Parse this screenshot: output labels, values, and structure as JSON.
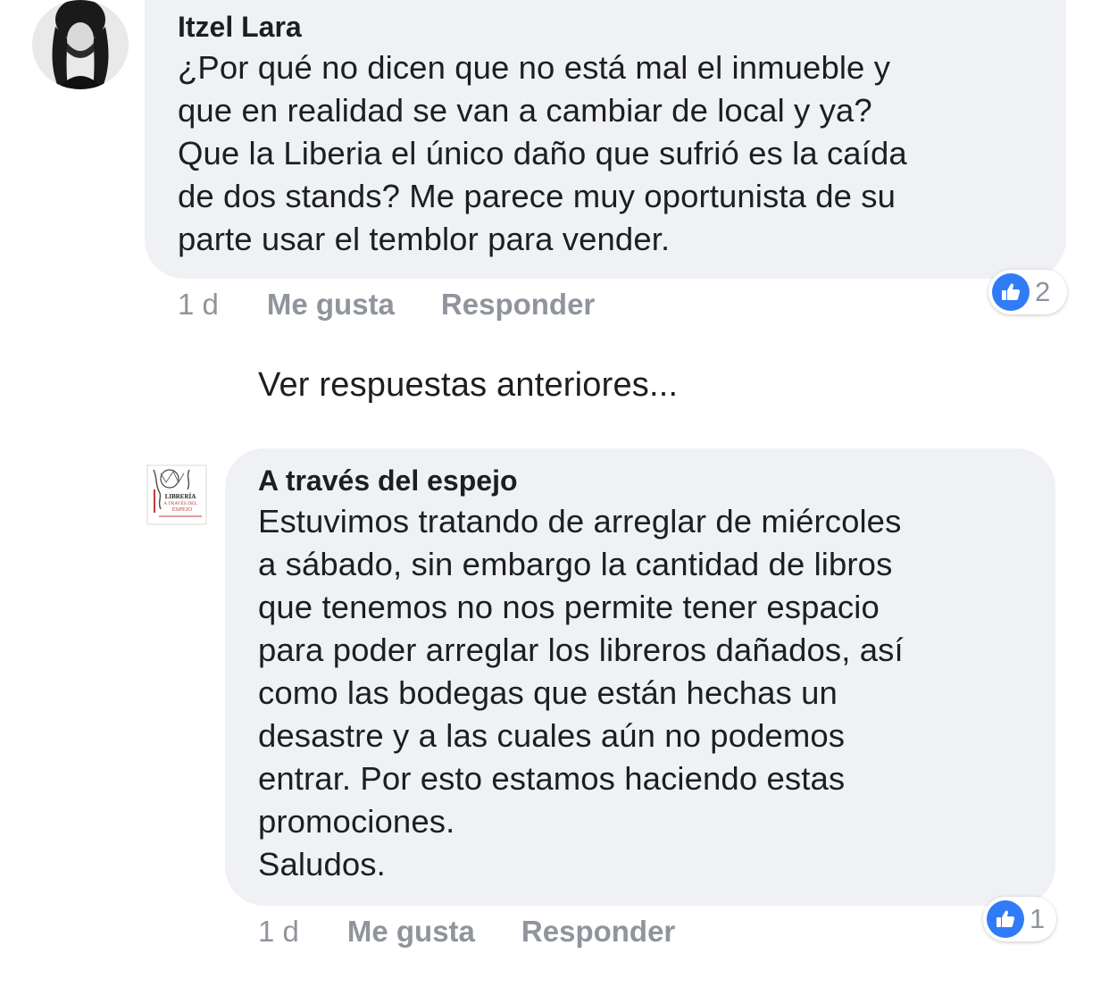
{
  "comments": [
    {
      "author": "Itzel Lara",
      "text": "¿Por qué no dicen que no está mal el inmueble y\nque en realidad se van a cambiar de local y ya?\nQue la Liberia el único daño que sufrió es la caída\nde dos stands? Me parece muy oportunista de su\nparte usar el temblor para vender.",
      "time": "1 d",
      "like_label": "Me gusta",
      "reply_label": "Responder",
      "reaction_count": "2",
      "avatar_icon": "user-avatar-photo"
    },
    {
      "author": "A través del espejo",
      "text": "Estuvimos tratando de arreglar de miércoles\na sábado, sin embargo la cantidad de libros\nque tenemos no nos permite tener espacio\npara poder arreglar los libreros dañados, así\ncomo las bodegas que están hechas un\ndesastre y a las cuales aún no podemos\nentrar. Por esto estamos haciendo estas\npromociones.\nSaludos.",
      "time": "1 d",
      "like_label": "Me gusta",
      "reply_label": "Responder",
      "reaction_count": "1",
      "avatar_icon": "bookstore-logo",
      "logo_text": {
        "line1": "LIBRERÍA",
        "line2": "A TRAVÉS DEL",
        "line3": "ESPEJO"
      }
    }
  ],
  "more_replies_label": "Ver respuestas anteriores...",
  "colors": {
    "bubble": "#f0f1f4",
    "meta_text": "#90949c",
    "like_blue": "#2f7cf6",
    "text": "#1c1e21"
  }
}
